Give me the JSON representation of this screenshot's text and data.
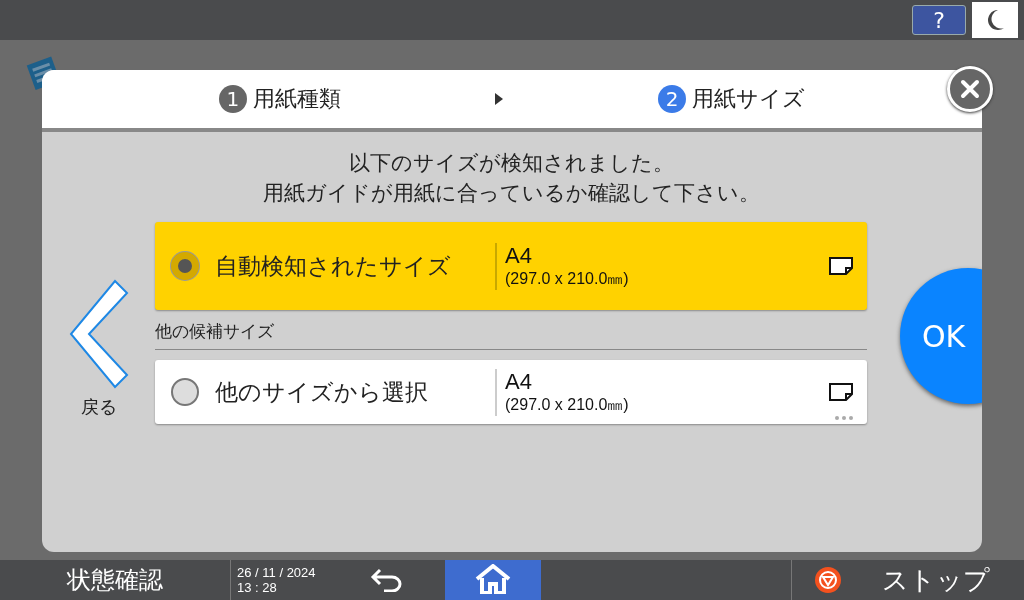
{
  "steps": [
    {
      "number": "1",
      "label": "用紙種類",
      "selected": false
    },
    {
      "number": "2",
      "label": "用紙サイズ",
      "selected": true
    }
  ],
  "message": [
    "以下のサイズが検知されました。",
    "用紙ガイドが用紙に合っているか確認して下さい。"
  ],
  "options": [
    {
      "label": "自動検知されたサイズ",
      "size": "A4",
      "dimensions": "(297.0 x 210.0㎜)",
      "selected": true,
      "more": false
    },
    {
      "label": "他のサイズから選択",
      "size": "A4",
      "dimensions": "(297.0 x 210.0㎜)",
      "selected": false,
      "more": true
    }
  ],
  "other_sizes_heading": "他の候補サイズ",
  "back_label": "戻る",
  "ok_label": "OK",
  "help_label": "?",
  "status_bar": {
    "status_label": "状態確認",
    "date": "26 / 11 / 2024",
    "time": "13 : 28",
    "stop_label": "ストップ"
  }
}
